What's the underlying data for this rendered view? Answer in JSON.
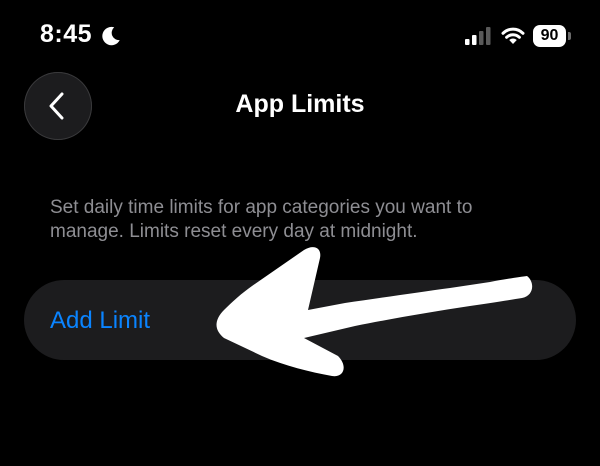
{
  "status_bar": {
    "time": "8:45",
    "focus_icon": "moon-icon",
    "signal_icon": "cellular-signal-icon",
    "wifi_icon": "wifi-icon",
    "battery_level": "90"
  },
  "nav": {
    "back_icon": "chevron-left-icon",
    "title": "App Limits"
  },
  "description": "Set daily time limits for app categories you want to manage. Limits reset every day at midnight.",
  "add_limit": {
    "label": "Add Limit"
  },
  "annotation": {
    "type": "hand-drawn-arrow",
    "points_to": "add_limit",
    "color": "#ffffff"
  },
  "colors": {
    "background": "#000000",
    "cell_background": "#1c1c1e",
    "accent": "#0a84ff",
    "secondary_text": "#8e8e93",
    "primary_text": "#ffffff"
  }
}
